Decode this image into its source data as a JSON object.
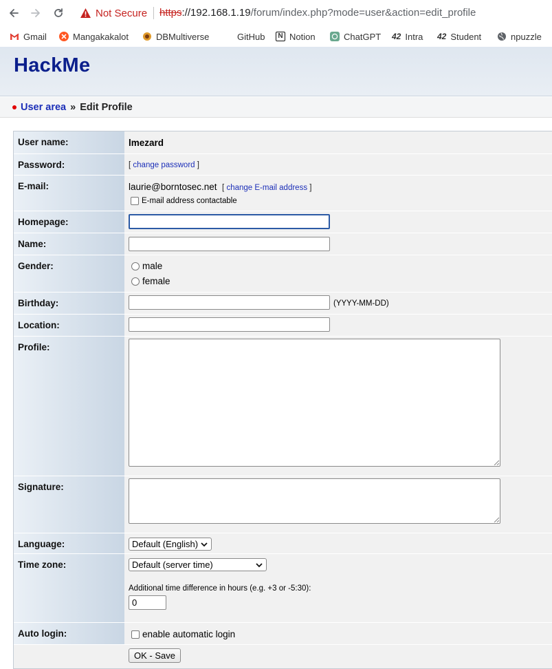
{
  "browser": {
    "security_label": "Not Secure",
    "url_scheme": "https",
    "url_host": "://192.168.1.19",
    "url_path": "/forum/index.php?mode=user&action=edit_profile",
    "bookmarks": [
      "Gmail",
      "Mangakakalot",
      "DBMultiverse",
      "GitHub",
      "Notion",
      "ChatGPT",
      "Intra",
      "Student",
      "npuzzle"
    ],
    "bookmark_icon_marks": {
      "notion": "N",
      "intra": "42",
      "student": "42"
    }
  },
  "header": {
    "logo": "HackMe"
  },
  "breadcrumb": {
    "parent": "User area",
    "separator": "»",
    "current": "Edit Profile"
  },
  "form": {
    "username": {
      "label": "User name:",
      "value": "lmezard"
    },
    "password": {
      "label": "Password:",
      "bracket_open": "[",
      "link": "change password",
      "bracket_close": "]"
    },
    "email": {
      "label": "E-mail:",
      "value": "laurie@borntosec.net",
      "bracket_open": "[",
      "link": "change E-mail address",
      "bracket_close": "]",
      "contactable_label": "E-mail address contactable"
    },
    "homepage": {
      "label": "Homepage:",
      "value": ""
    },
    "name": {
      "label": "Name:",
      "value": ""
    },
    "gender": {
      "label": "Gender:",
      "options": [
        "male",
        "female"
      ]
    },
    "birthday": {
      "label": "Birthday:",
      "value": "",
      "hint": "(YYYY-MM-DD)"
    },
    "location": {
      "label": "Location:",
      "value": ""
    },
    "profile": {
      "label": "Profile:"
    },
    "signature": {
      "label": "Signature:"
    },
    "language": {
      "label": "Language:",
      "selected": "Default (English)"
    },
    "timezone": {
      "label": "Time zone:",
      "selected": "Default (server time)",
      "diff_label": "Additional time difference in hours (e.g. +3 or -5:30):",
      "diff_value": "0"
    },
    "autologin": {
      "label": "Auto login:",
      "option": "enable automatic login"
    },
    "submit_label": "OK - Save"
  },
  "colors": {
    "logo": "#0b1f8c",
    "link": "#1c2fb8",
    "warning": "#c5221f"
  }
}
